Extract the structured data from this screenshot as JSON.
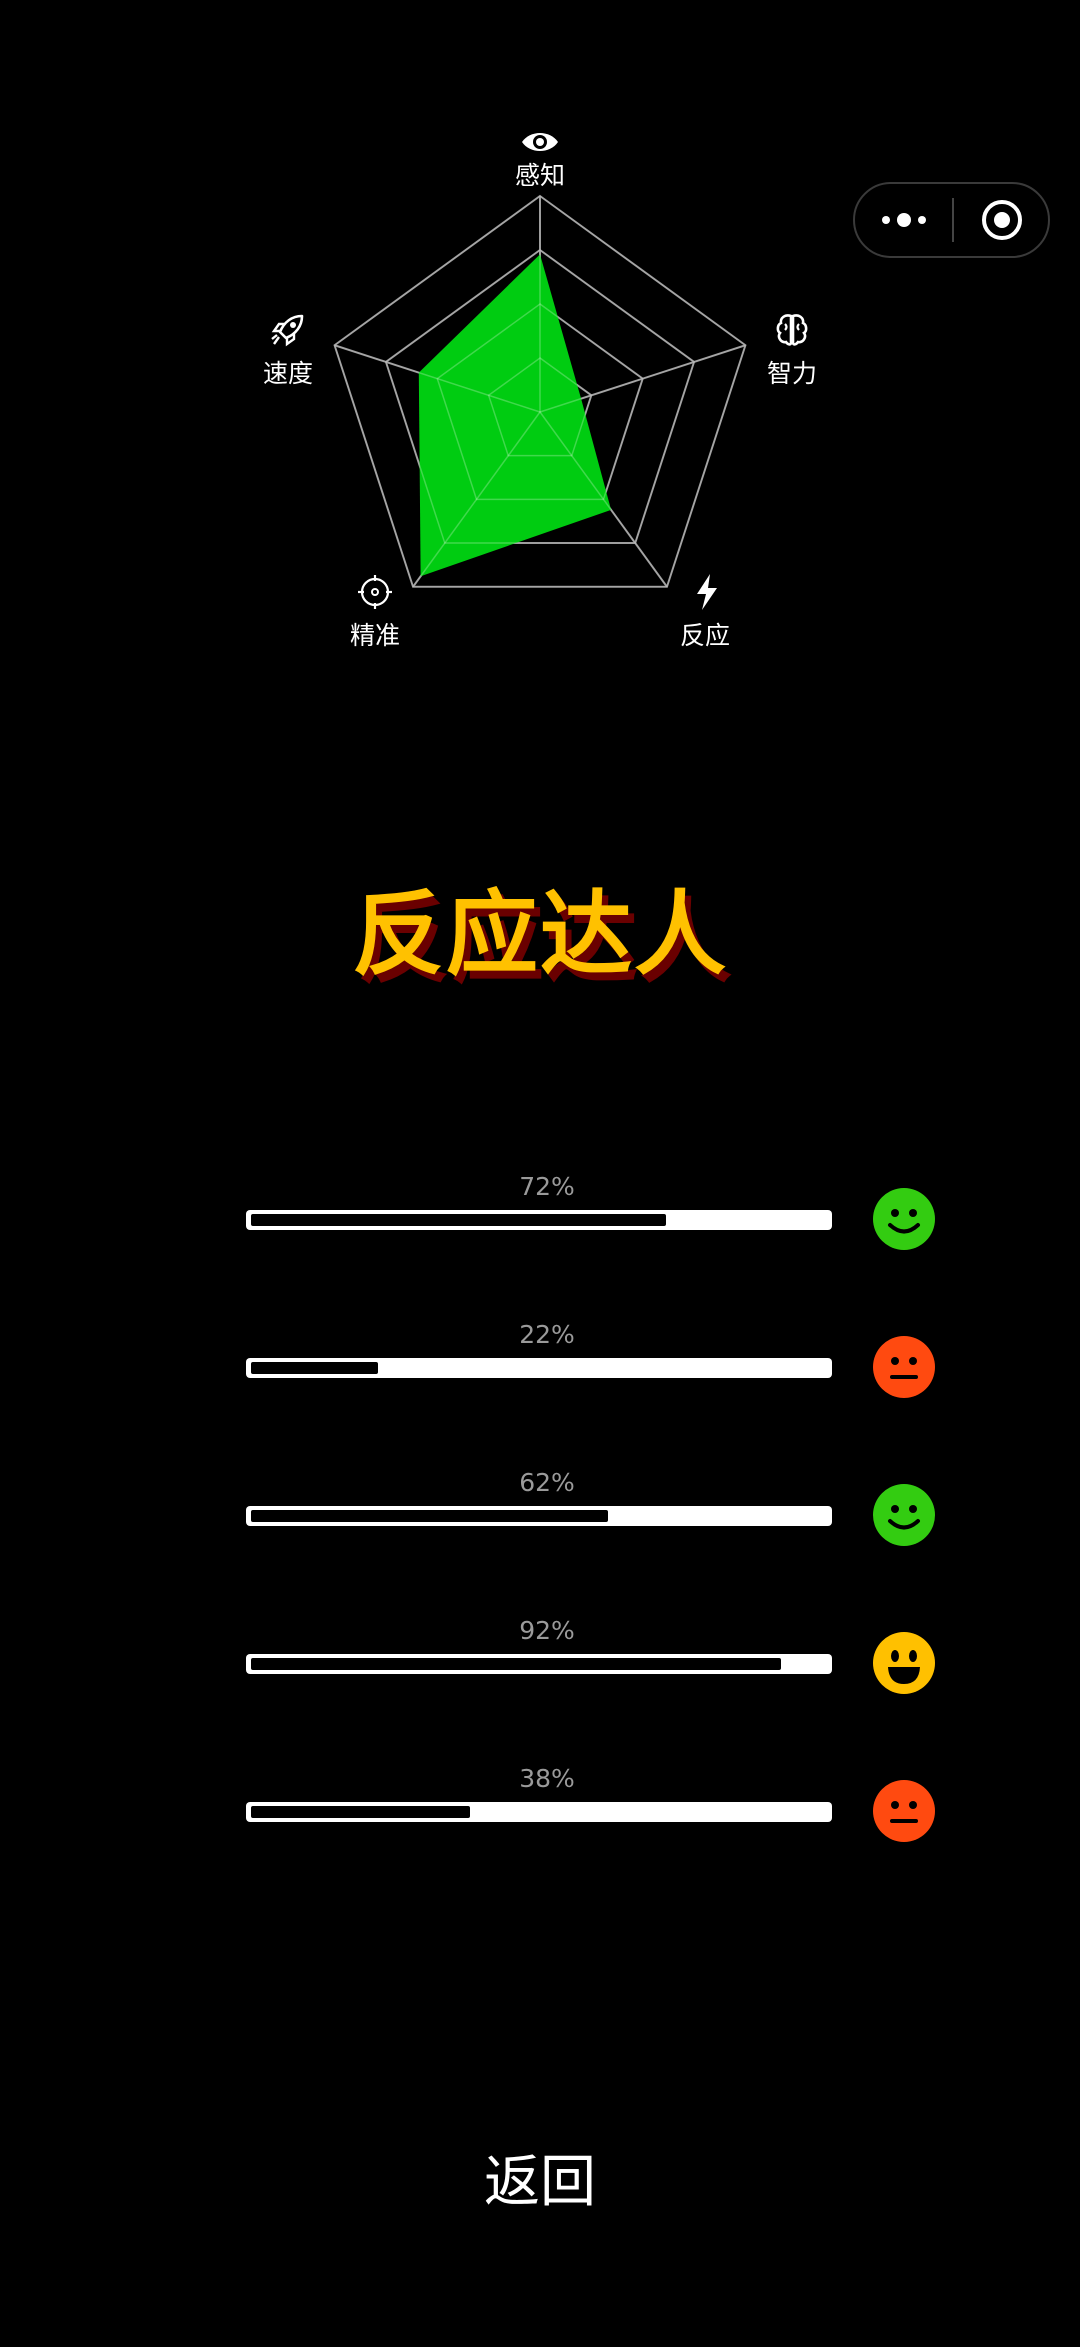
{
  "capsule": {
    "more_icon": "more-dots-icon",
    "close_icon": "target-close-icon"
  },
  "radar": {
    "axes": [
      {
        "key": "perception",
        "label": "感知",
        "icon": "eye-icon",
        "value": 0.73
      },
      {
        "key": "intelligence",
        "label": "智力",
        "icon": "brain-icon",
        "value": 0.2
      },
      {
        "key": "reaction",
        "label": "反应",
        "icon": "lightning-icon",
        "value": 0.56
      },
      {
        "key": "accuracy",
        "label": "精准",
        "icon": "crosshair-icon",
        "value": 0.94
      },
      {
        "key": "speed",
        "label": "速度",
        "icon": "rocket-icon",
        "value": 0.59
      }
    ],
    "grid_levels": 4,
    "fill_color": "#00cc11",
    "grid_color": "#888888"
  },
  "result_title": "反应达人",
  "bars": [
    {
      "percent_label": "72%",
      "value": 0.72,
      "face": "smile",
      "face_color": "#33cc11"
    },
    {
      "percent_label": "22%",
      "value": 0.22,
      "face": "neutral",
      "face_color": "#ff4a10"
    },
    {
      "percent_label": "62%",
      "value": 0.62,
      "face": "smile",
      "face_color": "#33cc11"
    },
    {
      "percent_label": "92%",
      "value": 0.92,
      "face": "grin",
      "face_color": "#ffc000"
    },
    {
      "percent_label": "38%",
      "value": 0.38,
      "face": "neutral",
      "face_color": "#ff4a10"
    }
  ],
  "back_label": "返回"
}
